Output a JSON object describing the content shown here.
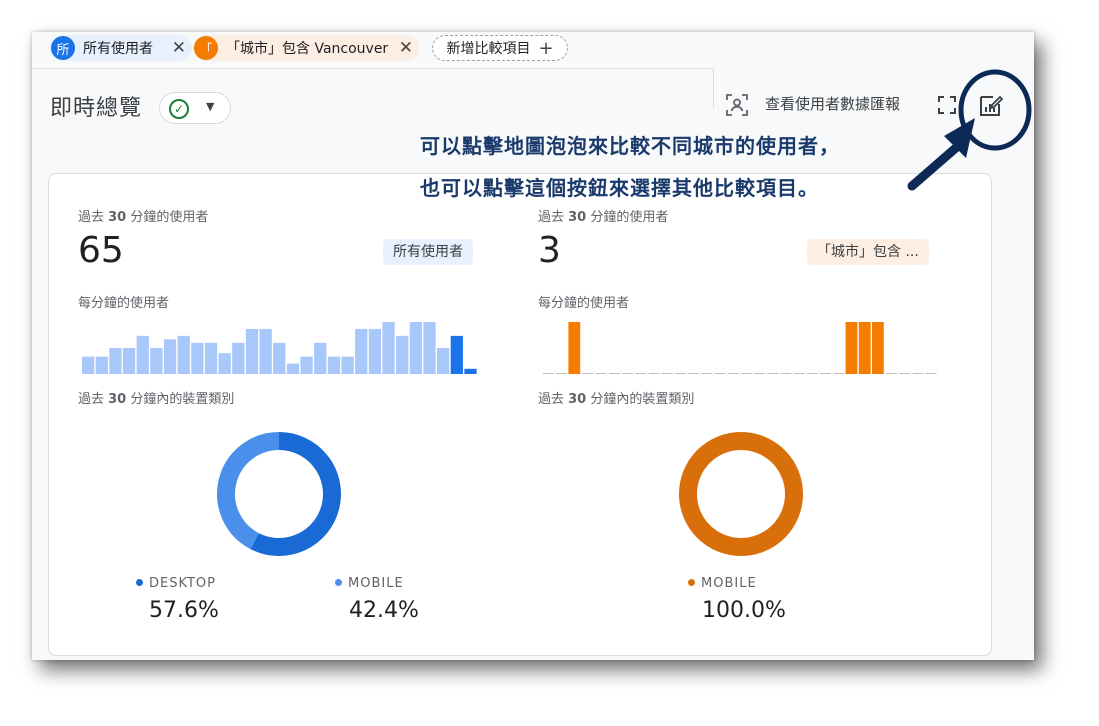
{
  "chips": {
    "all_users": {
      "avatar": "所",
      "label": "所有使用者"
    },
    "city": {
      "avatar": "「",
      "label": "「城市」包含 Vancouver"
    },
    "add": {
      "label": "新增比較項目"
    }
  },
  "header": {
    "title": "即時總覽",
    "user_report_label": "查看使用者數據匯報"
  },
  "annotation": {
    "line1": "可以點擊地圖泡泡來比較不同城市的使用者，",
    "line2": "也可以點擊這個按鈕來選擇其他比較項目。"
  },
  "panels": [
    {
      "users_label_pre": "過去 ",
      "users_label_num": "30",
      "users_label_post": " 分鐘的使用者",
      "users_value": "65",
      "tag": "所有使用者",
      "per_min_label": "每分鐘的使用者",
      "device_label_pre": "過去 ",
      "device_label_num": "30",
      "device_label_post": " 分鐘內的裝置類別",
      "legend": [
        {
          "name": "DESKTOP",
          "value": "57.6%"
        },
        {
          "name": "MOBILE",
          "value": "42.4%"
        }
      ]
    },
    {
      "users_label_pre": "過去 ",
      "users_label_num": "30",
      "users_label_post": " 分鐘的使用者",
      "users_value": "3",
      "tag": "「城市」包含 ...",
      "per_min_label": "每分鐘的使用者",
      "device_label_pre": "過去 ",
      "device_label_num": "30",
      "device_label_post": " 分鐘內的裝置類別",
      "legend": [
        {
          "name": "MOBILE",
          "value": "100.0%"
        }
      ]
    }
  ],
  "colors": {
    "primary_blue": "#1a73e8",
    "light_blue": "#a8c7fa",
    "desktop_blue": "#1a6ad6",
    "mobile_blue": "#4a8fea",
    "orange": "#f57c00",
    "mobile_orange": "#d86f0a",
    "annotation": "#1a3a6b"
  },
  "chart_data": [
    {
      "type": "bar",
      "title": "每分鐘的使用者",
      "series": [
        {
          "name": "所有使用者",
          "values": [
            1,
            1,
            1.5,
            1.5,
            2.2,
            1.5,
            2,
            2.2,
            1.8,
            1.8,
            1.2,
            1.8,
            2.6,
            2.6,
            1.8,
            0.6,
            1,
            1.8,
            1,
            1,
            2.6,
            2.6,
            3,
            2.2,
            3,
            3,
            1.5,
            2.2,
            0.3
          ]
        }
      ],
      "highlight_last": true
    },
    {
      "type": "bar",
      "title": "每分鐘的使用者",
      "series": [
        {
          "name": "「城市」包含 Vancouver",
          "values": [
            0,
            0,
            1,
            0,
            0,
            0,
            0,
            0,
            0,
            0,
            0,
            0,
            0,
            0,
            0,
            0,
            0,
            0,
            0,
            0,
            0,
            0,
            0,
            1,
            1,
            1,
            0,
            0,
            0,
            0
          ]
        }
      ]
    },
    {
      "type": "pie",
      "title": "過去 30 分鐘內的裝置類別",
      "series": [
        {
          "name": "所有使用者",
          "labels": [
            "DESKTOP",
            "MOBILE"
          ],
          "values": [
            57.6,
            42.4
          ]
        }
      ]
    },
    {
      "type": "pie",
      "title": "過去 30 分鐘內的裝置類別",
      "series": [
        {
          "name": "「城市」包含 Vancouver",
          "labels": [
            "MOBILE"
          ],
          "values": [
            100.0
          ]
        }
      ]
    }
  ]
}
